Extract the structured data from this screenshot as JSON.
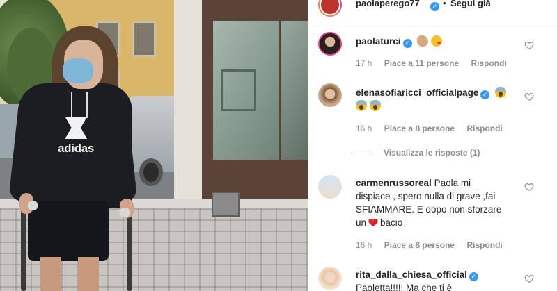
{
  "post": {
    "username": "paolaperego77",
    "follow_label": "Segui già",
    "dot": "•"
  },
  "comments": [
    {
      "username": "paolaturci",
      "text": "",
      "emojis": [
        "flexed-biceps",
        "winking-face-kiss"
      ],
      "time": "17 h",
      "likes": "Piace a 11 persone",
      "reply": "Rispondi"
    },
    {
      "username": "elenasofiaricci_officialpage",
      "text": "",
      "emojis": [
        "face-screaming",
        "face-screaming",
        "face-screaming"
      ],
      "time": "16 h",
      "likes": "Piace a 8 persone",
      "reply": "Rispondi",
      "view_replies": "Visualizza le risposte (1)"
    },
    {
      "username": "carmenrussoreal",
      "text_line1": "Paola mi",
      "text_line2": "dispiace , spero nulla di grave ,fai",
      "text_line3": "SFIAMMARE. E dopo non sforzare",
      "text_line4_before": "un",
      "text_line4_after": "bacio",
      "time": "16 h",
      "likes": "Piace a 8 persone",
      "reply": "Rispondi"
    },
    {
      "username": "rita_dalla_chiesa_official",
      "text_line1": "Paoletta!!!!! Ma che ti è"
    }
  ],
  "colors": {
    "verified": "#3897f0",
    "meta_text": "#8e8e8e",
    "text": "#262626",
    "heart_red": "#ed4956"
  },
  "photo": {
    "shirt_text": "adidas"
  }
}
